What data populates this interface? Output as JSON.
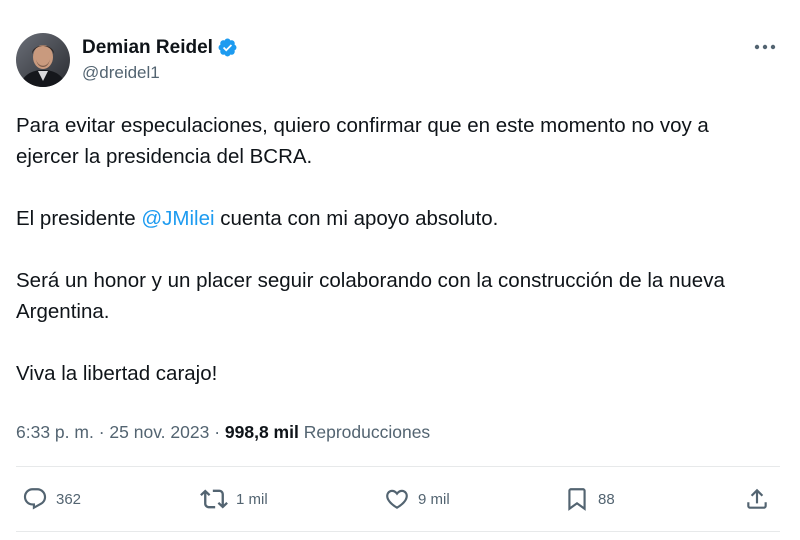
{
  "author": {
    "display_name": "Demian Reidel",
    "handle": "@dreidel1",
    "verified_icon": "verified-badge-icon",
    "avatar_icon": "avatar-photo"
  },
  "tweet": {
    "paragraphs": [
      {
        "text": "Para evitar especulaciones, quiero confirmar que en este momento no voy a ejercer la presidencia del BCRA."
      },
      {
        "before": "El presidente ",
        "mention": "@JMilei",
        "after": " cuenta con mi apoyo absoluto."
      },
      {
        "text": "Será un honor y un placer seguir colaborando con la construcción de la nueva Argentina."
      },
      {
        "text": "Viva la libertad carajo!"
      }
    ],
    "time": "6:33 p. m.",
    "separator": "·",
    "date": "25 nov. 2023",
    "views_count": "998,8 mil",
    "views_label": "Reproducciones"
  },
  "actions": {
    "replies": "362",
    "retweets": "1 mil",
    "likes": "9 mil",
    "bookmarks": "88"
  },
  "colors": {
    "accent": "#1d9bf0",
    "text": "#0f1419",
    "secondary": "#536471",
    "divider": "#e7e9ea"
  }
}
